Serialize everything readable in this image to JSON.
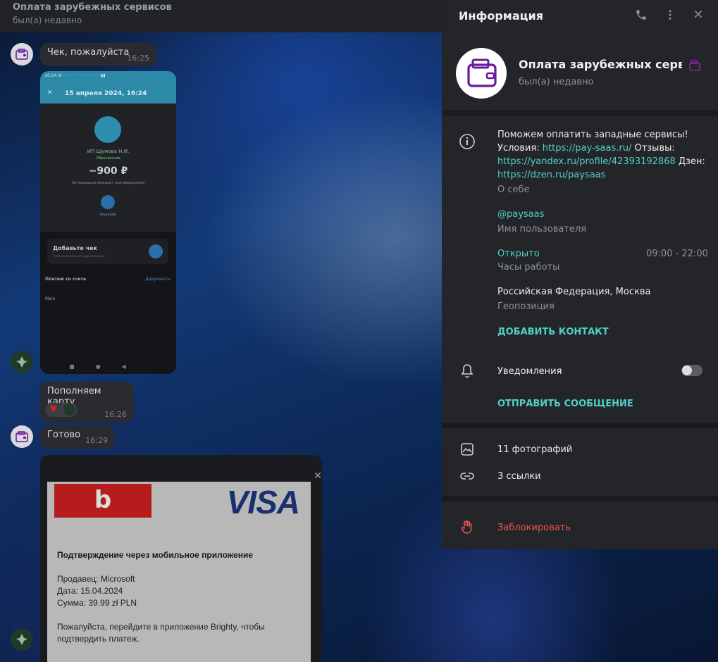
{
  "chat": {
    "header": {
      "title": "Оплата зарубежных сервисов",
      "status": "был(а) недавно"
    },
    "messages": [
      {
        "text": "Чек, пожалуйста",
        "time": "16:25"
      },
      {
        "text": "Пополняем карту",
        "time": "16:26"
      },
      {
        "text": "Готово",
        "time": "16:29"
      }
    ],
    "phone_screenshot": {
      "date": "15 апреля 2024, 16:24",
      "name": "ИП Шумова Н.И.",
      "category": "Образование",
      "amount": "−900 ₽",
      "auth": "Авторизация ожидает подтверждения",
      "decline": "Решение",
      "add_receipt": "Добавьте чек",
      "add_receipt_sub": "Чтобы заказ был откорректирован",
      "payment_from": "Платеж со счета",
      "documents": "Документы",
      "main": "Main"
    },
    "visa_screenshot": {
      "brand": "b",
      "visa": "VISA",
      "heading": "Подтверждение через мобильное приложение",
      "seller": "Продавец: Microsoft",
      "date": "Дата: 15.04.2024",
      "sum": "Сумма: 39.99 zł PLN",
      "instruction_1": "Пожалуйста, перейдите в приложение Brighty, чтобы",
      "instruction_2": "подтвердить платеж."
    }
  },
  "panel": {
    "title": "Информация",
    "profile": {
      "name": "Оплата зарубежных серви...",
      "status": "был(а) недавно"
    },
    "about": {
      "line1": "Поможем оплатить западные сервисы!",
      "cond_prefix": "Условия: ",
      "cond_link": "https://pay-saas.ru/",
      "reviews_prefix": " Отзывы:",
      "reviews_link": "https://yandex.ru/profile/42393192868",
      "dzen_prefix": " Дзен:",
      "dzen_link": "https://dzen.ru/paysaas",
      "label": "О себе"
    },
    "username": {
      "value": "@paysaas",
      "label": "Имя пользователя"
    },
    "hours": {
      "status": "Открыто",
      "range": "09:00 - 22:00",
      "label": "Часы работы"
    },
    "location": {
      "value": "Российская Федерация, Москва",
      "label": "Геопозиция"
    },
    "add_contact": "ДОБАВИТЬ КОНТАКТ",
    "notifications": "Уведомления",
    "send_message": "ОТПРАВИТЬ СООБЩЕНИЕ",
    "photos": "11 фотографий",
    "links": "3 ссылки",
    "block": "Заблокировать"
  },
  "colors": {
    "accent": "#4fd1c5",
    "danger": "#ef5350",
    "panel_bg": "#242529"
  }
}
